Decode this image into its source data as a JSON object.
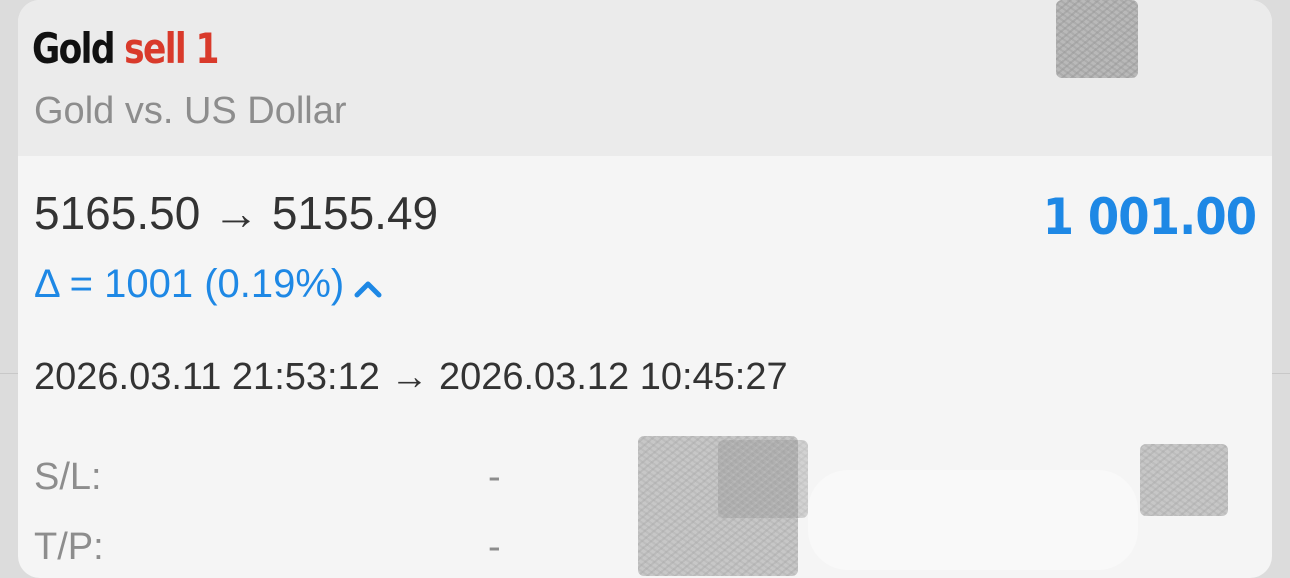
{
  "position": {
    "symbol": "Gold",
    "side_and_volume": "sell 1",
    "description": "Gold vs. US Dollar",
    "prices": "5165.50 → 5155.49",
    "profit": "1 001.00",
    "delta": "Δ = 1001 (0.19%)",
    "times": "2026.03.11 21:53:12 → 2026.03.12 10:45:27",
    "sl_label": "S/L:",
    "sl_value": "-",
    "tp_label": "T/P:",
    "tp_value": "-"
  },
  "colors": {
    "sell": "#d93a2b",
    "profit": "#1e88e5",
    "muted": "#8d8d8d"
  },
  "icons": {
    "delta_direction": "chevron-up-icon"
  }
}
